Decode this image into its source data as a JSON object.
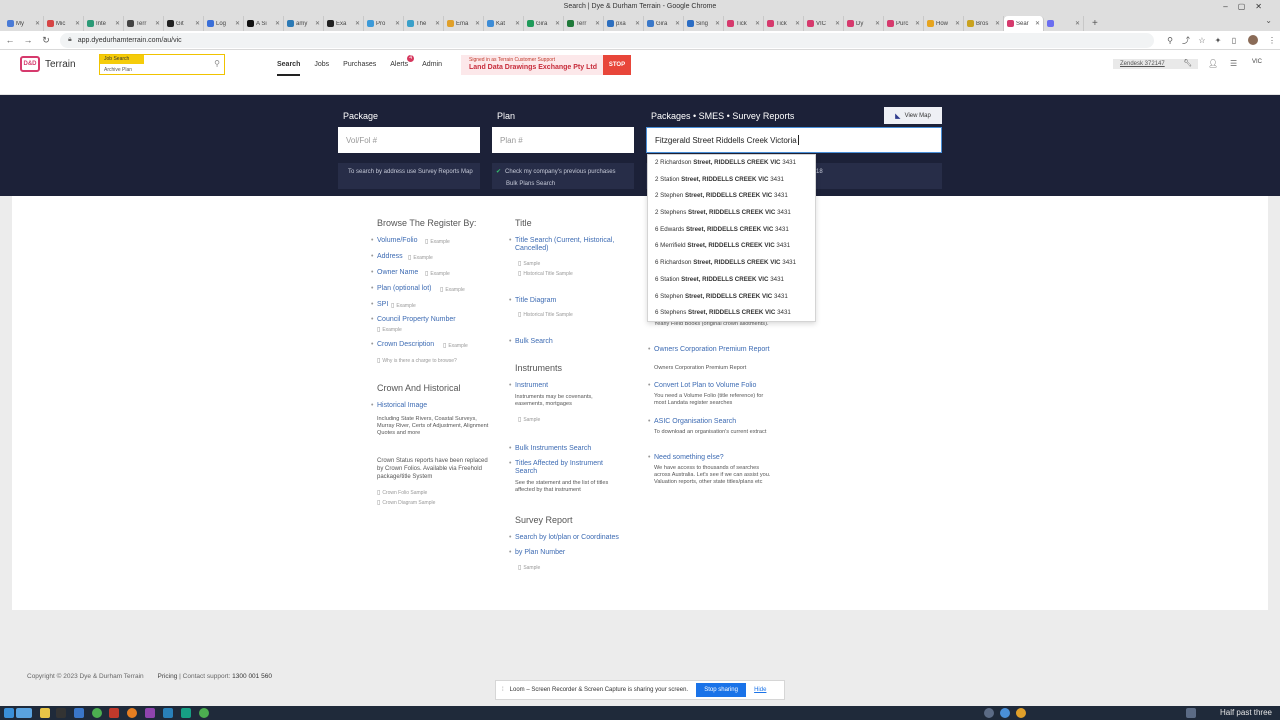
{
  "window": {
    "title": "Search | Dye & Durham Terrain - Google Chrome"
  },
  "tabs": [
    {
      "label": "My",
      "color": "#4a7bd6"
    },
    {
      "label": "Mic",
      "color": "#d64545"
    },
    {
      "label": "Inte",
      "color": "#2b9a76"
    },
    {
      "label": "Terr",
      "color": "#444444"
    },
    {
      "label": "Git",
      "color": "#222222"
    },
    {
      "label": "Log",
      "color": "#3a6fd8"
    },
    {
      "label": "A Si",
      "color": "#111111"
    },
    {
      "label": "amy",
      "color": "#2c7ab5"
    },
    {
      "label": "Exa",
      "color": "#222222"
    },
    {
      "label": "Pro",
      "color": "#3c9ad8"
    },
    {
      "label": "The",
      "color": "#3aa0c9"
    },
    {
      "label": "Ema",
      "color": "#e0a02a"
    },
    {
      "label": "Kat",
      "color": "#3d8cd6"
    },
    {
      "label": "Gira",
      "color": "#1f9b5a"
    },
    {
      "label": "Terr",
      "color": "#1f7a3a"
    },
    {
      "label": "pxa",
      "color": "#2d6fbf"
    },
    {
      "label": "Gira",
      "color": "#3a78c9"
    },
    {
      "label": "Sing",
      "color": "#2b6dc4"
    },
    {
      "label": "Tick",
      "color": "#d63a6d"
    },
    {
      "label": "Tick",
      "color": "#d63a6d"
    },
    {
      "label": "VIC",
      "color": "#d63a6d"
    },
    {
      "label": "Dy",
      "color": "#d63a6d"
    },
    {
      "label": "Purc",
      "color": "#d63a6d"
    },
    {
      "label": "How",
      "color": "#e6a41f"
    },
    {
      "label": "Bros",
      "color": "#c9a21f"
    },
    {
      "label": "Sear",
      "color": "#d63a6d",
      "active": true
    },
    {
      "label": "",
      "color": "#6b6ef0"
    }
  ],
  "address": {
    "url": "app.dyedurhamterrain.com/au/vic"
  },
  "header": {
    "logo_mark": "D&D",
    "logo_text": "Terrain",
    "job_search_label": "Job Search",
    "archive_plan_label": "Archive Plan",
    "nav": [
      {
        "label": "Search",
        "active": true
      },
      {
        "label": "Jobs"
      },
      {
        "label": "Purchases"
      },
      {
        "label": "Alerts",
        "badge": "4"
      },
      {
        "label": "Admin"
      }
    ],
    "signed_in_text": "Signed in as Terrain Customer Support",
    "signed_in_org": "Land Data Drawings Exchange Pty Ltd",
    "stop_label": "STOP",
    "zendesk_label": "Zendesk 372147",
    "region": "VIC"
  },
  "search": {
    "package_title": "Package",
    "package_placeholder": "Vol/Fol #",
    "plan_title": "Plan",
    "plan_placeholder": "Plan #",
    "survey_title": "Packages • SMES • Survey Reports",
    "view_map_label": "View Map",
    "survey_value": "Fitzgerald Street Riddells Creek Victoria",
    "package_tip": "To search by address use Survey Reports Map",
    "plan_tip_1": "Check my company's previous purchases",
    "plan_tip_2": "Bulk Plans Search",
    "survey_tip_tail": "18"
  },
  "autocomplete": [
    {
      "num": "2 Richardson",
      "street": "Street, RIDDELLS CREEK VIC",
      "pc": "3431"
    },
    {
      "num": "2 Station",
      "street": "Street, RIDDELLS CREEK VIC",
      "pc": "3431"
    },
    {
      "num": "2 Stephen",
      "street": "Street, RIDDELLS CREEK VIC",
      "pc": "3431"
    },
    {
      "num": "2 Stephens",
      "street": "Street, RIDDELLS CREEK VIC",
      "pc": "3431"
    },
    {
      "num": "6 Edwards",
      "street": "Street, RIDDELLS CREEK VIC",
      "pc": "3431"
    },
    {
      "num": "6 Merrifield",
      "street": "Street, RIDDELLS CREEK VIC",
      "pc": "3431"
    },
    {
      "num": "6 Richardson",
      "street": "Street, RIDDELLS CREEK VIC",
      "pc": "3431"
    },
    {
      "num": "6 Station",
      "street": "Street, RIDDELLS CREEK VIC",
      "pc": "3431"
    },
    {
      "num": "6 Stephen",
      "street": "Street, RIDDELLS CREEK VIC",
      "pc": "3431"
    },
    {
      "num": "6 Stephens",
      "street": "Street, RIDDELLS CREEK VIC",
      "pc": "3431"
    }
  ],
  "browse": {
    "title": "Browse The Register By:",
    "volume_folio": "Volume/Folio",
    "address": "Address",
    "owner_name": "Owner Name",
    "plan": "Plan (optional lot)",
    "spi": "SPI",
    "council": "Council Property Number",
    "crown_desc": "Crown Description",
    "example": "Example",
    "browse_charge": "Why is there a charge to browse?",
    "crown_hist_title": "Crown And Historical",
    "historical_image": "Historical Image",
    "historical_desc": "Including State Rivers, Coastal Surveys, Murray River, Certs of Adjustment, Alignment Quotes and more",
    "crown_status": "Crown Status reports have been replaced by Crown Folios. Available via Freehold package/title System",
    "crown_folio_sample": "Crown Folio Sample",
    "crown_diagram_sample": "Crown Diagram Sample"
  },
  "title_col": {
    "title": "Title",
    "title_search": "Title Search (Current, Historical, Cancelled)",
    "sample": "Sample",
    "historical_title_sample": "Historical Title Sample",
    "title_diagram": "Title Diagram",
    "bulk_search": "Bulk Search",
    "instruments_title": "Instruments",
    "instrument": "Instrument",
    "instrument_desc": "Instruments may be covenants, easements, mortgages",
    "bulk_instruments": "Bulk Instruments Search",
    "titles_affected": "Titles Affected by Instrument Search",
    "titles_affected_desc": "See the statement and the list of titles affected by that instrument",
    "survey_report_title": "Survey Report",
    "search_lot": "Search by lot/plan or Coordinates",
    "by_plan": "by Plan Number"
  },
  "other_col": {
    "field_books_desc": "Yearly Field Books (original crown allotments).",
    "owners_corp": "Owners Corporation Premium Report",
    "owners_corp_desc": "Owners Corporation Premium Report",
    "convert_lot": "Convert Lot Plan to Volume Folio",
    "convert_desc": "You need a Volume Folio (title reference) for most Landata register searches",
    "asic": "ASIC Organisation Search",
    "asic_desc": "To download an organisation's current extract",
    "need_else": "Need something else?",
    "need_else_desc": "We have access to thousands of searches across Australia. Let's see if we can assist you. Valuation reports, other state titles/plans etc"
  },
  "footer": {
    "copyright": "Copyright © 2023 Dye & Durham Terrain",
    "pricing": "Pricing",
    "contact": "| Contact support:",
    "phone": "1300 001 560"
  },
  "loom": {
    "text": "Loom – Screen Recorder & Screen Capture is sharing your screen.",
    "stop": "Stop sharing",
    "hide": "Hide"
  },
  "taskbar": {
    "time": "Half past three"
  }
}
